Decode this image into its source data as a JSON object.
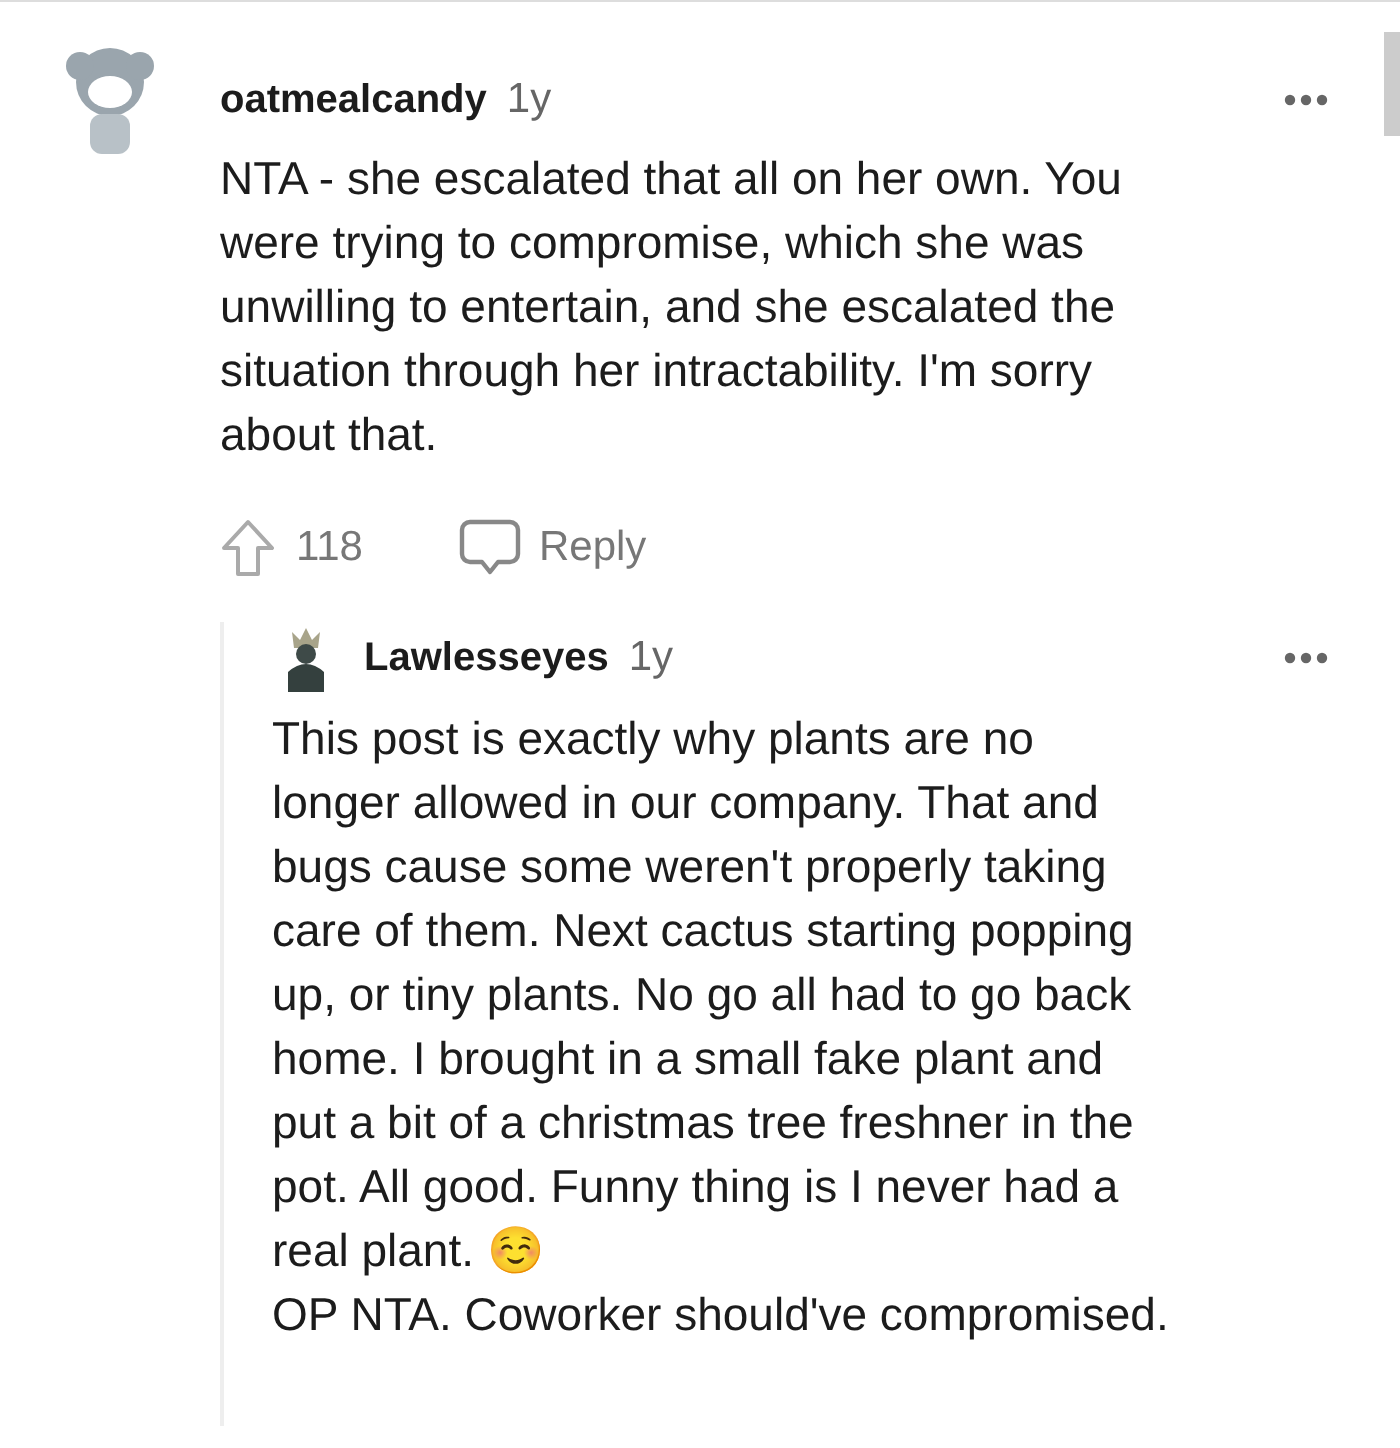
{
  "comment": {
    "author": "oatmealcandy",
    "age": "1y",
    "body": "NTA - she escalated that all on her own. You\nwere trying to compromise, which she was\nunwilling to entertain, and she escalated the\nsituation through her intractability. I'm sorry\nabout that.",
    "upvotes": "118",
    "reply_label": "Reply"
  },
  "reply": {
    "author": "Lawlesseyes",
    "age": "1y",
    "body": "This post is exactly why plants are no\nlonger allowed in our company. That and\nbugs cause some weren't properly taking\ncare of them. Next cactus starting popping\nup, or tiny plants. No go all had to go back\nhome. I brought in a small fake plant and\nput a bit of a christmas tree freshner in the\npot. All good. Funny thing is I never had a\nreal plant. ☺️\nOP NTA. Coworker should've compromised."
  }
}
